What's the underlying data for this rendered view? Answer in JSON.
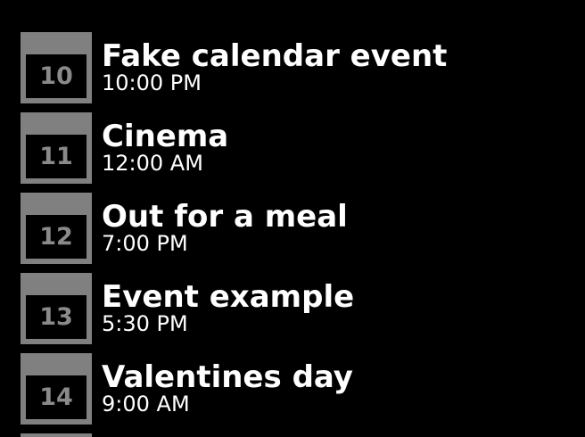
{
  "events": [
    {
      "day": "10",
      "title": "Fake calendar event",
      "time": "10:00 PM"
    },
    {
      "day": "11",
      "title": "Cinema",
      "time": "12:00 AM"
    },
    {
      "day": "12",
      "title": "Out for a meal",
      "time": "7:00 PM"
    },
    {
      "day": "13",
      "title": "Event example",
      "time": "5:30 PM"
    },
    {
      "day": "14",
      "title": "Valentines day",
      "time": "9:00 AM"
    }
  ],
  "colors": {
    "background": "#000000",
    "date_icon": "#808080",
    "date_number": "#8a8a8a",
    "text": "#ffffff"
  }
}
